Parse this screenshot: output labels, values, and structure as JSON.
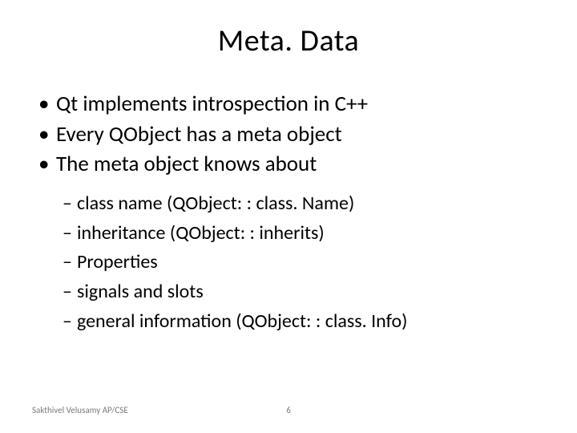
{
  "title": "Meta. Data",
  "bullets": [
    "Qt implements introspection in C++",
    "Every QObject has a meta object",
    "The meta object knows about"
  ],
  "sub_bullets": [
    "class name (QObject: : class. Name)",
    "inheritance (QObject: : inherits)",
    "Properties",
    "signals and slots",
    "general information (QObject: : class. Info)"
  ],
  "footer": {
    "author": "Sakthivel Velusamy AP/CSE",
    "page": "6"
  }
}
